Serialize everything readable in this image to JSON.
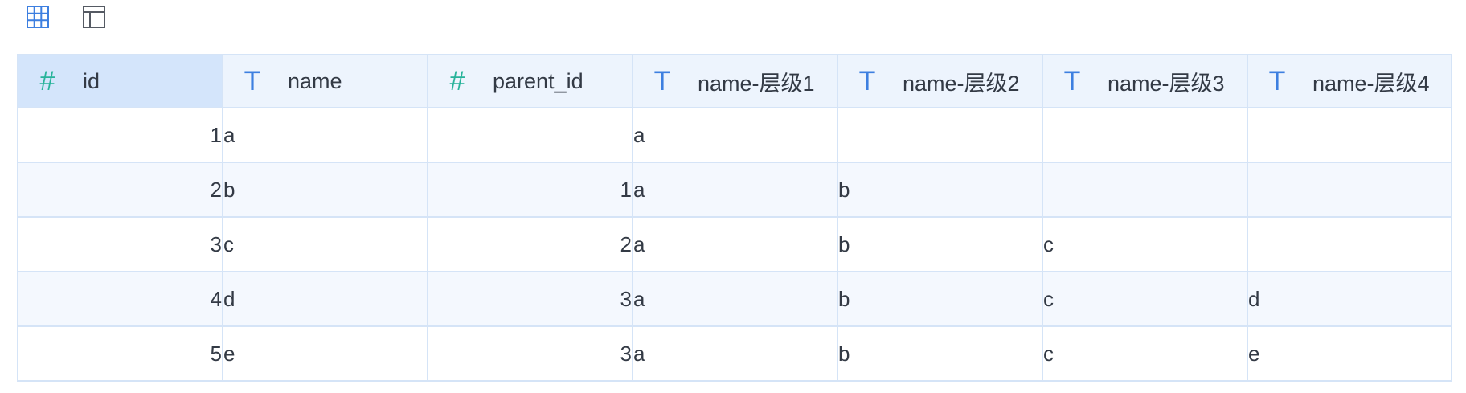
{
  "toolbar": {
    "buttons": [
      {
        "icon": "table-grid-icon",
        "active": true,
        "color": "#3d7fe0"
      },
      {
        "icon": "layout-panel-icon",
        "active": false,
        "color": "#555a63"
      }
    ]
  },
  "table": {
    "columns": [
      {
        "label": "id",
        "type_icon": "#",
        "type": "number"
      },
      {
        "label": "name",
        "type_icon": "T",
        "type": "text"
      },
      {
        "label": "parent_id",
        "type_icon": "#",
        "type": "number"
      },
      {
        "label": "name-层级1",
        "type_icon": "T",
        "type": "text"
      },
      {
        "label": "name-层级2",
        "type_icon": "T",
        "type": "text"
      },
      {
        "label": "name-层级3",
        "type_icon": "T",
        "type": "text"
      },
      {
        "label": "name-层级4",
        "type_icon": "T",
        "type": "text"
      }
    ],
    "rows": [
      [
        "1",
        "a",
        "",
        "a",
        "",
        "",
        ""
      ],
      [
        "2",
        "b",
        "1",
        "a",
        "b",
        "",
        ""
      ],
      [
        "3",
        "c",
        "2",
        "a",
        "b",
        "c",
        ""
      ],
      [
        "4",
        "d",
        "3",
        "a",
        "b",
        "c",
        "d"
      ],
      [
        "5",
        "e",
        "3",
        "a",
        "b",
        "c",
        "e"
      ]
    ]
  },
  "colors": {
    "header_bg": "#edf4fd",
    "header_selected_bg": "#d4e5fb",
    "border": "#d5e4f7",
    "number_icon": "#27b39a",
    "text_icon": "#3d7fe0"
  }
}
